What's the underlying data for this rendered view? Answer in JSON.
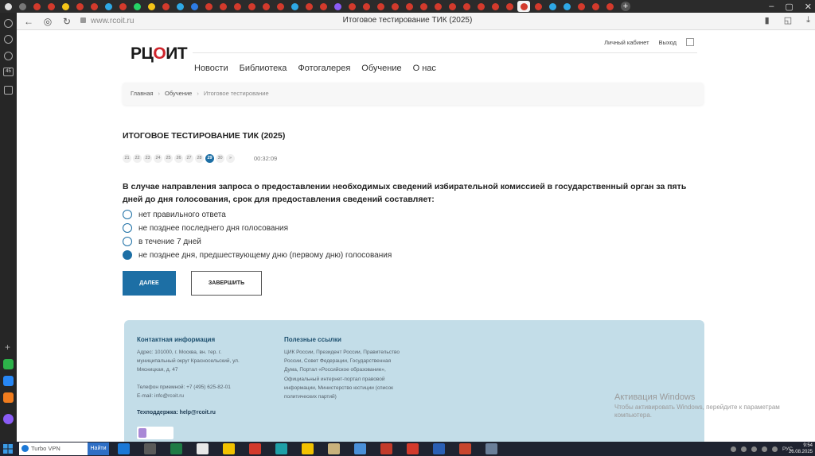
{
  "browser": {
    "tab_colors": [
      "#e0e0e0",
      "#777777",
      "#d33a2c",
      "#d33a2c",
      "#f5c518",
      "#d33a2c",
      "#d33a2c",
      "#2ea8e5",
      "#d33a2c",
      "#25d366",
      "#f5c518",
      "#d33a2c",
      "#2ea8e5",
      "#2d7be5",
      "#d33a2c",
      "#d33a2c",
      "#d33a2c",
      "#d33a2c",
      "#d33a2c",
      "#d33a2c",
      "#2ea8e5",
      "#d33a2c",
      "#d33a2c",
      "#8b5cf6",
      "#d33a2c",
      "#d33a2c",
      "#d33a2c",
      "#d33a2c",
      "#d33a2c",
      "#d33a2c",
      "#d33a2c",
      "#d33a2c",
      "#d33a2c",
      "#d33a2c",
      "#d33a2c",
      "#d33a2c",
      "#d33a2c",
      "#d33a2c",
      "#2ea8e5",
      "#2ea8e5",
      "#d33a2c",
      "#d33a2c",
      "#d33a2c"
    ],
    "url": "www.rcoit.ru",
    "title": "Итоговое тестирование ТИК (2025)"
  },
  "sidebar": {
    "badge": "45"
  },
  "site": {
    "logo_main": "РЦ",
    "logo_accent": "О",
    "logo_end": "ИТ",
    "cabinet_link": "Личный кабинет",
    "logout_link": "Выход",
    "nav": [
      "Новости",
      "Библиотека",
      "Фотогалерея",
      "Обучение",
      "О нас"
    ],
    "breadcrumb": [
      "Главная",
      "Обучение",
      "Итоговое тестирование"
    ]
  },
  "test": {
    "title": "ИТОГОВОЕ ТЕСТИРОВАНИЕ ТИК (2025)",
    "question_numbers": [
      "21",
      "22",
      "23",
      "24",
      "25",
      "26",
      "27",
      "28",
      "29",
      "30",
      "»"
    ],
    "current_question": "29",
    "timer": "00:32:09",
    "question": "В случае направления запроса о предоставлении необходимых сведений избирательной комиссией в государственный орган за пять дней до дня голосования, срок для предоставления сведений составляет:",
    "answers": [
      {
        "text": "нет правильного ответа",
        "checked": false
      },
      {
        "text": "не позднее последнего дня голосования",
        "checked": false
      },
      {
        "text": "в течение 7 дней",
        "checked": false
      },
      {
        "text": "не позднее дня, предшествующему дню (первому дню) голосования",
        "checked": true
      }
    ],
    "next_label": "ДАЛЕЕ",
    "finish_label": "ЗАВЕРШИТЬ"
  },
  "footer": {
    "contact_title": "Контактная информация",
    "address": "Адрес: 101000, г. Москва, вн. тер. г. муниципальный округ Красносельский, ул. Мясницкая, д. 47",
    "phone": "Телефон приемной: +7 (495) 625-82-01",
    "email": "E-mail: info@rcoit.ru",
    "support": "Техподдержка: help@rcoit.ru",
    "links_title": "Полезные ссылки",
    "links": "ЦИК России, Президент России, Правительство России, Совет Федерации, Государственная Дума, Портал «Российское образование», Официальный интернет-портал правовой информации, Министерство юстиции (список политических партий)"
  },
  "activation": {
    "title": "Активация Windows",
    "text": "Чтобы активировать Windows, перейдите к параметрам компьютера."
  },
  "taskbar": {
    "search_value": "Turbo VPN",
    "search_button": "Найти",
    "app_colors": [
      "#1b78d6",
      "#5a5a5a",
      "#1e7b45",
      "#e8e8e8",
      "#f2c200",
      "#d33a2c",
      "#1fa0a8",
      "#f2c200",
      "#c9b27c",
      "#4a90d9",
      "#c23b2b",
      "#d33a2c",
      "#2b5fb4",
      "#c8462e",
      "#6b7f99"
    ],
    "language": "РУС",
    "time": "9:54",
    "date": "26.08.2025"
  }
}
